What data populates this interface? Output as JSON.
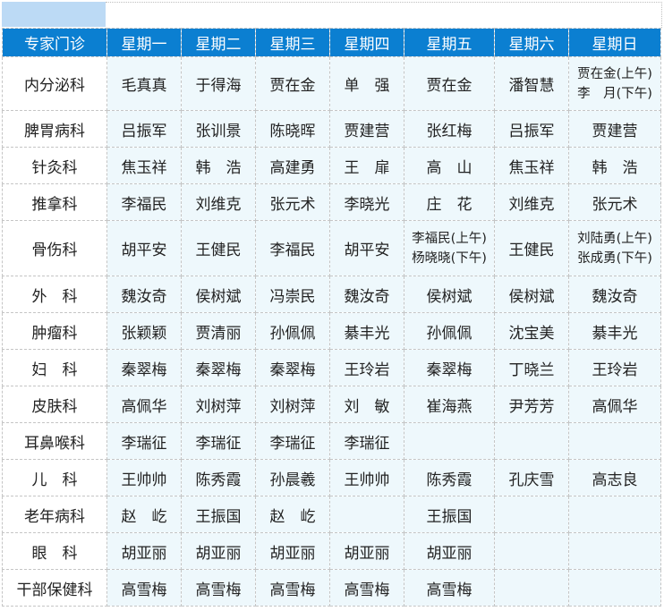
{
  "headers": [
    "专家门诊",
    "星期一",
    "星期二",
    "星期三",
    "星期四",
    "星期五",
    "星期六",
    "星期日"
  ],
  "rows": [
    {
      "dept": "内分泌科",
      "cells": [
        [
          "毛真真"
        ],
        [
          "于得海"
        ],
        [
          "贾在金"
        ],
        [
          "单　强"
        ],
        [
          "贾在金"
        ],
        [
          "潘智慧"
        ],
        [
          "贾在金(上午)",
          "李　月(下午)"
        ]
      ]
    },
    {
      "dept": "脾胃病科",
      "cells": [
        [
          "吕振军"
        ],
        [
          "张训景"
        ],
        [
          "陈晓晖"
        ],
        [
          "贾建营"
        ],
        [
          "张红梅"
        ],
        [
          "吕振军"
        ],
        [
          "贾建营"
        ]
      ]
    },
    {
      "dept": "针灸科",
      "cells": [
        [
          "焦玉祥"
        ],
        [
          "韩　浩"
        ],
        [
          "高建勇"
        ],
        [
          "王　扉"
        ],
        [
          "高　山"
        ],
        [
          "焦玉祥"
        ],
        [
          "韩　浩"
        ]
      ]
    },
    {
      "dept": "推拿科",
      "cells": [
        [
          "李福民"
        ],
        [
          "刘维克"
        ],
        [
          "张元术"
        ],
        [
          "李晓光"
        ],
        [
          "庄　花"
        ],
        [
          "刘维克"
        ],
        [
          "张元术"
        ]
      ]
    },
    {
      "dept": "骨伤科",
      "cells": [
        [
          "胡平安"
        ],
        [
          "王健民"
        ],
        [
          "李福民"
        ],
        [
          "胡平安"
        ],
        [
          "李福民(上午)",
          "杨晓晓(下午)"
        ],
        [
          "王健民"
        ],
        [
          "刘陆勇(上午)",
          "张成勇(下午)"
        ]
      ]
    },
    {
      "dept": "外　科",
      "cells": [
        [
          "魏汝奇"
        ],
        [
          "侯树斌"
        ],
        [
          "冯崇民"
        ],
        [
          "魏汝奇"
        ],
        [
          "侯树斌"
        ],
        [
          "侯树斌"
        ],
        [
          "魏汝奇"
        ]
      ]
    },
    {
      "dept": "肿瘤科",
      "cells": [
        [
          "张颖颖"
        ],
        [
          "贾清丽"
        ],
        [
          "孙佩佩"
        ],
        [
          "綦丰光"
        ],
        [
          "孙佩佩"
        ],
        [
          "沈宝美"
        ],
        [
          "綦丰光"
        ]
      ]
    },
    {
      "dept": "妇　科",
      "cells": [
        [
          "秦翠梅"
        ],
        [
          "秦翠梅"
        ],
        [
          "秦翠梅"
        ],
        [
          "王玲岩"
        ],
        [
          "秦翠梅"
        ],
        [
          "丁晓兰"
        ],
        [
          "王玲岩"
        ]
      ]
    },
    {
      "dept": "皮肤科",
      "cells": [
        [
          "高佩华"
        ],
        [
          "刘树萍"
        ],
        [
          "刘树萍"
        ],
        [
          "刘　敏"
        ],
        [
          "崔海燕"
        ],
        [
          "尹芳芳"
        ],
        [
          "高佩华"
        ]
      ]
    },
    {
      "dept": "耳鼻喉科",
      "cells": [
        [
          "李瑞征"
        ],
        [
          "李瑞征"
        ],
        [
          "李瑞征"
        ],
        [
          "李瑞征"
        ],
        [],
        [],
        []
      ]
    },
    {
      "dept": "儿　科",
      "cells": [
        [
          "王帅帅"
        ],
        [
          "陈秀霞"
        ],
        [
          "孙晨羲"
        ],
        [
          "王帅帅"
        ],
        [
          "陈秀霞"
        ],
        [
          "孔庆雪"
        ],
        [
          "高志良"
        ]
      ]
    },
    {
      "dept": "老年病科",
      "cells": [
        [
          "赵　屹"
        ],
        [
          "王振国"
        ],
        [
          "赵　屹"
        ],
        [],
        [
          "王振国"
        ],
        [],
        []
      ]
    },
    {
      "dept": "眼　科",
      "cells": [
        [
          "胡亚丽"
        ],
        [
          "胡亚丽"
        ],
        [
          "胡亚丽"
        ],
        [
          "胡亚丽"
        ],
        [
          "胡亚丽"
        ],
        [],
        []
      ]
    },
    {
      "dept": "干部保健科",
      "cells": [
        [
          "高雪梅"
        ],
        [
          "高雪梅"
        ],
        [
          "高雪梅"
        ],
        [
          "高雪梅"
        ],
        [
          "高雪梅"
        ],
        [],
        []
      ]
    }
  ]
}
